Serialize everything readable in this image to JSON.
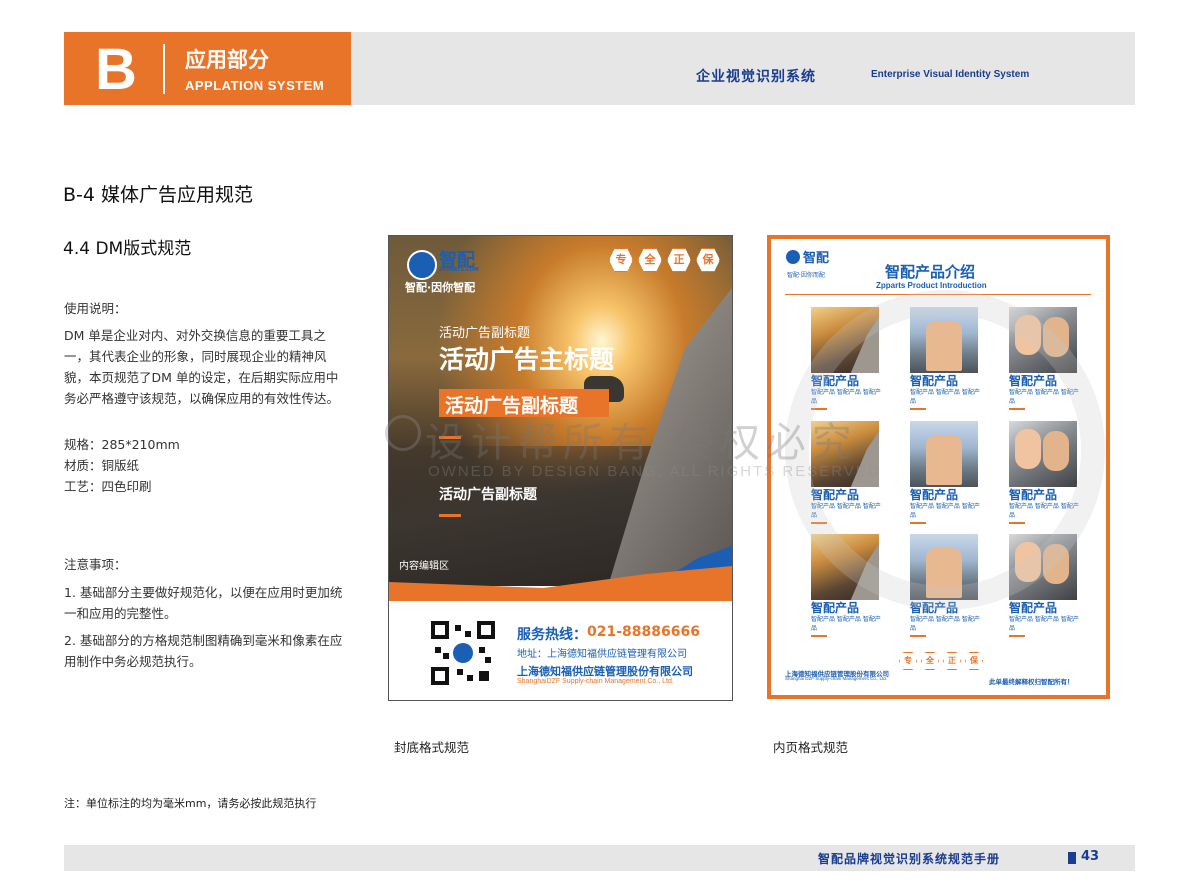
{
  "header": {
    "letter": "B",
    "title_cn": "应用部分",
    "title_en": "APPLATION SYSTEM",
    "right_cn": "企业视觉识别系统",
    "right_en": "Enterprise Visual Identity System"
  },
  "section": {
    "title": "B-4  媒体广告应用规范",
    "subtitle": "4.4 DM版式规范"
  },
  "usage": {
    "heading": "使用说明：",
    "paragraph": "DM 单是企业对内、对外交换信息的重要工具之一，其代表企业的形象，同时展现企业的精神风貌，本页规范了DM 单的设定，在后期实际应用中务必严格遵守该规范，以确保应用的有效性传达。",
    "specs": [
      "规格：285*210mm",
      "材质：铜版纸",
      "工艺：四色印刷"
    ]
  },
  "notes": {
    "heading": "注意事项：",
    "items": [
      "1. 基础部分主要做好规范化，以便在应用时更加统一和应用的完整性。",
      "2. 基础部分的方格规范制图精确到毫米和像素在应用制作中务必规范执行。"
    ]
  },
  "footnote": "注：单位标注的均为毫米mm，请务必按此规范执行",
  "dm_cover": {
    "logo_text": "智配",
    "logo_sub": "ZPPARTS.COM",
    "slogan": "智配·因你智配",
    "badges": [
      "专",
      "全",
      "正",
      "保"
    ],
    "subtitle_1": "活动广告副标题",
    "main_title": "活动广告主标题",
    "subtitle_2": "活动广告副标题",
    "subtitle_3": "活动广告副标题",
    "content_area": "内容编辑区",
    "hotline_label": "服务热线：",
    "hotline": "021-88886666",
    "address": "地址：上海德知福供应链管理有限公司",
    "company": "上海德知福供应链管理股份有限公司",
    "company_en": "ShanghaiDZF Supply-chain Management Co., Ltd.",
    "caption": "封底格式规范"
  },
  "dm_inner": {
    "logo_text": "智配",
    "slogan": "智配·因你而配",
    "title": "智配产品介绍",
    "title_en": "Zpparts Product Introduction",
    "products": [
      {
        "name": "智配产品",
        "desc": "智配产品 智配产品 智配产品",
        "img": "car"
      },
      {
        "name": "智配产品",
        "desc": "智配产品 智配产品 智配产品",
        "img": "people"
      },
      {
        "name": "智配产品",
        "desc": "智配产品 智配产品 智配产品",
        "img": "couple"
      },
      {
        "name": "智配产品",
        "desc": "智配产品 智配产品 智配产品",
        "img": "car"
      },
      {
        "name": "智配产品",
        "desc": "智配产品 智配产品 智配产品",
        "img": "people"
      },
      {
        "name": "智配产品",
        "desc": "智配产品 智配产品 智配产品",
        "img": "couple"
      },
      {
        "name": "智配产品",
        "desc": "智配产品 智配产品 智配产品",
        "img": "car"
      },
      {
        "name": "智配产品",
        "desc": "智配产品 智配产品 智配产品",
        "img": "people"
      },
      {
        "name": "智配产品",
        "desc": "智配产品 智配产品 智配产品",
        "img": "couple"
      }
    ],
    "badges": [
      "专",
      "全",
      "正",
      "保"
    ],
    "company": "上海德知福供应链管理股份有限公司",
    "company_en": "Shanghai DZF Supply-chain Management Co., Ltd.",
    "rights": "此单最终解释权归智配所有！",
    "caption": "内页格式规范"
  },
  "watermark": {
    "cn": "设计帮所有 侵权必究",
    "en": "OWNED BY DESIGN BANG, ALL RIGHTS RESERVED"
  },
  "footer": {
    "text": "智配品牌视觉识别系统规范手册",
    "page": "43"
  },
  "colors": {
    "orange": "#e8742a",
    "blue": "#1a5fb4",
    "navy": "#1a3d8f",
    "gray_bar": "#e6e6e6"
  }
}
